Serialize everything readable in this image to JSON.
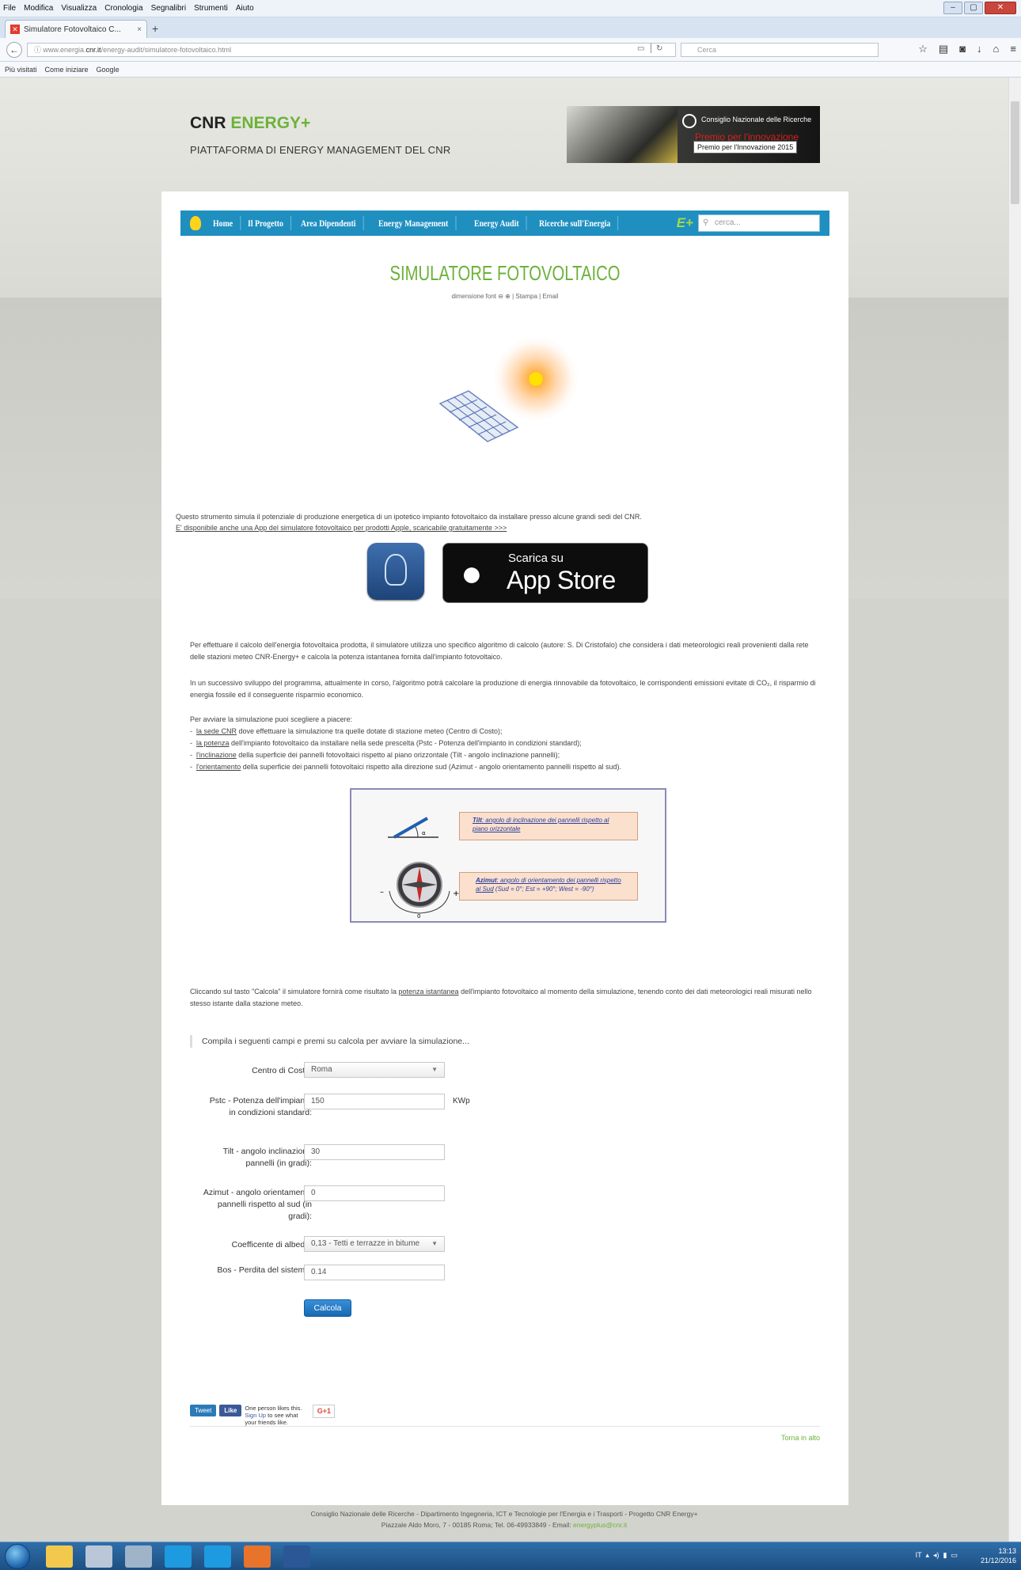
{
  "browser": {
    "menu": [
      "File",
      "Modifica",
      "Visualizza",
      "Cronologia",
      "Segnalibri",
      "Strumenti",
      "Aiuto"
    ],
    "tab_title": "Simulatore Fotovoltaico C...",
    "url_prefix": "www.energia.",
    "url_host": "cnr.it",
    "url_path": "/energy-audit/simulatore-fotovoltaico.html",
    "search_placeholder": "Cerca",
    "bookmarks": [
      "Più visitati",
      "Come iniziare",
      "Google"
    ]
  },
  "header": {
    "brand_main": "CNR",
    "brand_accent": "ENERGY+",
    "subtitle": "PIATTAFORMA DI ENERGY MANAGEMENT DEL CNR",
    "award_org": "Consiglio Nazionale delle Ricerche",
    "award_text": "Premio per l'innovazione",
    "award_tooltip": "Premio per l'Innovazione 2015"
  },
  "nav": {
    "items": [
      "Home",
      "Il Progetto",
      "Area Dipendenti",
      "Energy Management",
      "Energy Audit",
      "Ricerche sull'Energia"
    ],
    "logo_text": "E+",
    "search_placeholder": "cerca..."
  },
  "page": {
    "title": "SIMULATORE FOTOVOLTAICO",
    "tools": "dimensione font ⊖ ⊕ | Stampa | Email",
    "intro_1": "Questo strumento simula il potenziale di produzione energetica di un ipotetico impianto fotovoltaico da installare presso alcune grandi sedi del CNR.",
    "intro_2": "E' disponibile anche una App del simulatore fotovoltaico per prodotti Apple, scaricabile gratuitamente >>>",
    "appstore_small": "Scarica su",
    "appstore_big": "App Store",
    "para_1": "Per effettuare il calcolo dell'energia fotovoltaica prodotta, il simulatore utilizza uno specifico algoritmo di calcolo (autore: S. Di Cristofalo) che considera i dati meteorologici reali provenienti dalla rete delle stazioni meteo CNR-Energy+ e calcola la potenza istantanea fornita dall'impianto fotovoltaico.",
    "para_2": "In un successivo sviluppo del programma, attualmente in corso, l'algoritmo potrà calcolare la produzione di energia rinnovabile da fotovoltaico, le corrispondenti emissioni evitate di CO₂, il risparmio di energia fossile ed il conseguente risparmio economico.",
    "para_3_title": "Per avviare la simulazione puoi scegliere a piacere:",
    "list": [
      {
        "link": "la sede CNR",
        "text": " dove effettuare la simulazione tra quelle dotate di stazione meteo (Centro di Costo);"
      },
      {
        "link": "la potenza",
        "text": " dell'impianto fotovoltaico da installare nella sede prescelta (Pstc - Potenza dell'impianto in condizioni standard);"
      },
      {
        "link": "l'inclinazione",
        "text": " della superficie dei pannelli fotovoltaici rispetto al piano orizzontale (Tilt - angolo inclinazione pannelli);"
      },
      {
        "link": "l'orientamento",
        "text": " della superficie dei pannelli fotovoltaici rispetto alla direzione sud (Azimut - angolo orientamento pannelli rispetto al sud)."
      }
    ],
    "tilt_bold": "Tilt",
    "tilt_text": ": angolo di inclinazione dei pannelli rispetto al piano orizzontale",
    "azimut_bold": "Azimut",
    "azimut_text": ": angolo di orientamento dei pannelli rispetto al Sud",
    "azimut_values": " (Sud = 0°; Est = +90°; West = -90°)",
    "para_4_a": "Cliccando sul tasto \"Calcola\" il simulatore fornirà come risultato la ",
    "para_4_link": "potenza istantanea",
    "para_4_b": " dell'impianto fotovoltaico al momento della simulazione, tenendo conto dei dati meteorologici reali misurati nello stesso istante dalla stazione meteo.",
    "form_intro": "Compila i seguenti campi e premi su calcola per avviare la simulazione..."
  },
  "form": {
    "centro_label": "Centro di Costo:",
    "centro_value": "Roma",
    "pstc_label": "Pstc - Potenza dell'impianto in condizioni standard:",
    "pstc_value": "150",
    "pstc_unit": "KWp",
    "tilt_label": "Tilt - angolo inclinazione pannelli (in gradi):",
    "tilt_value": "30",
    "azimut_label": "Azimut - angolo orientamento pannelli rispetto al sud (in gradi):",
    "azimut_value": "0",
    "albedo_label": "Coefficente di albedo:",
    "albedo_value": "0,13 - Tetti e terrazze in bitume",
    "bos_label": "Bos - Perdita del sistema:",
    "bos_value": "0.14",
    "button": "Calcola"
  },
  "social": {
    "tweet": "Tweet",
    "like": "Like",
    "like_text_a": "One person likes this. ",
    "like_link": "Sign Up",
    "like_text_b": " to see what your friends like.",
    "gplus": "G+1",
    "back_top": "Torna in alto"
  },
  "footer": {
    "line_1": "Consiglio Nazionale delle Ricerche - Dipartimento Ingegneria, ICT e Tecnologie per l'Energia e i Trasporti - Progetto CNR Energy+",
    "line_2": "Piazzale Aldo Moro, 7 - 00185 Roma; Tel. 06-49933849 - Email: ",
    "email": "energyplus@cnr.it"
  },
  "taskbar": {
    "lang": "IT",
    "time": "13:13",
    "date": "21/12/2016"
  },
  "colors": {
    "accent_green": "#6cb23a",
    "nav_blue": "#1f8fc0",
    "button_blue": "#1769b3"
  }
}
